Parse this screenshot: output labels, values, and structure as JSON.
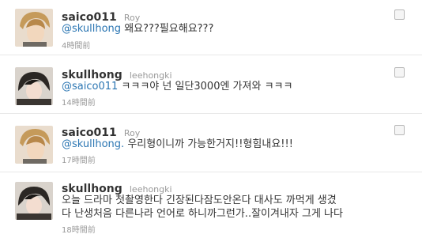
{
  "tweets": [
    {
      "screen_name": "saico011",
      "full_name": "Roy",
      "mention": "@skullhong",
      "text": " 왜요???필요해요???",
      "time": "4時間前"
    },
    {
      "screen_name": "skullhong",
      "full_name": "leehongki",
      "mention": "@saico011",
      "text": " ㅋㅋㅋ야 넌 일단3000엔 가져와 ㅋㅋㅋ",
      "time": "14時間前"
    },
    {
      "screen_name": "saico011",
      "full_name": "Roy",
      "mention": "@skullhong.",
      "text": " 우리형이니까 가능한거지!!형힘내요!!!",
      "time": "17時間前"
    },
    {
      "screen_name": "skullhong",
      "full_name": "leehongki",
      "text_line1": "오늘 드라마 첫촬영한다 긴장된다잠도안온다 대사도 까먹게 생겼",
      "text_line2": "다 난생처음 다른나라 언어로 하니까그런가..잘이겨내자 그게 나다",
      "time": "18時間前"
    }
  ],
  "icons": {
    "favorite": "star-outline-icon",
    "avatar": "user-avatar-photo"
  },
  "colors": {
    "mention": "#2a75b2",
    "meta": "#999999",
    "screen_name": "#333333"
  }
}
